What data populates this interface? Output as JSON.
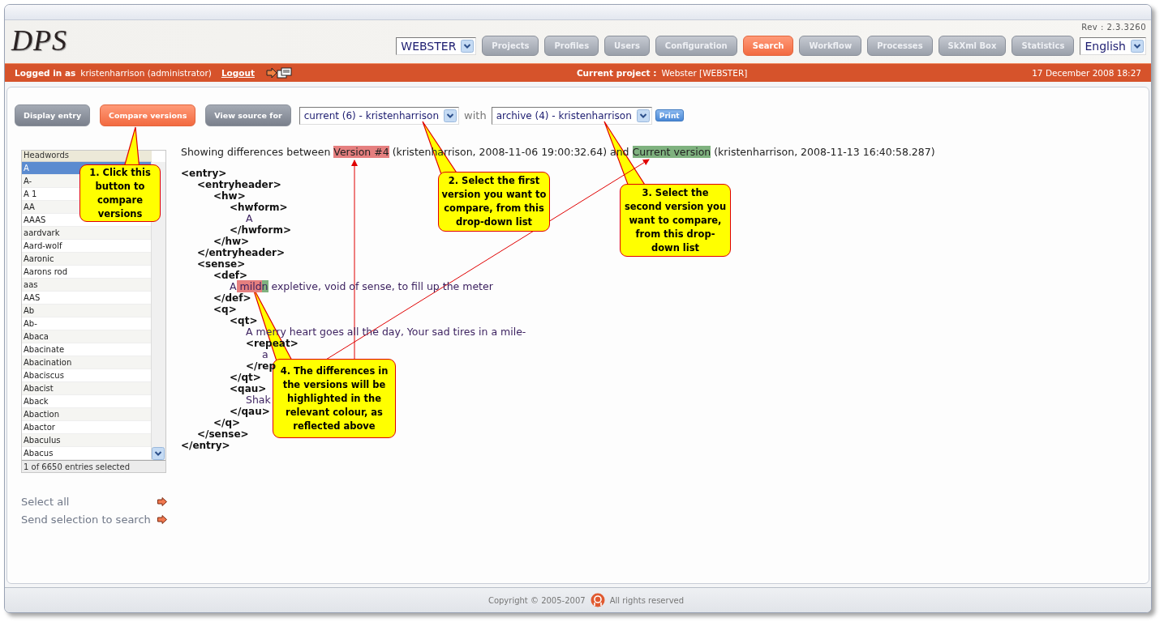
{
  "header": {
    "logo": "DPS",
    "revision": "Rev : 2.3.3260",
    "dictionary_select": "WEBSTER",
    "language_select": "English",
    "nav": [
      {
        "label": "Projects",
        "selected": false
      },
      {
        "label": "Profiles",
        "selected": false
      },
      {
        "label": "Users",
        "selected": false
      },
      {
        "label": "Configuration",
        "selected": false
      },
      {
        "label": "Search",
        "selected": true
      },
      {
        "label": "Workflow",
        "selected": false
      },
      {
        "label": "Processes",
        "selected": false
      },
      {
        "label": "SkXml Box",
        "selected": false
      },
      {
        "label": "Statistics",
        "selected": false
      }
    ]
  },
  "user_bar": {
    "logged_in_label": "Logged in as",
    "user": "kristenharrison (administrator)",
    "logout": "Logout",
    "current_project_label": "Current project :",
    "current_project": "Webster [WEBSTER]",
    "datetime": "17 December 2008 18:27"
  },
  "toolbar": {
    "modes": [
      {
        "label": "Display entry",
        "selected": false
      },
      {
        "label": "Compare versions",
        "selected": true
      },
      {
        "label": "View source for",
        "selected": false
      }
    ],
    "first_version": "current (6) - kristenharrison",
    "with_label": "with",
    "second_version": "archive (4) - kristenharrison",
    "print": "Print"
  },
  "headwords": {
    "heading": "Headwords",
    "status": "1 of 6650 entries selected",
    "items": [
      {
        "label": "A",
        "selected": true
      },
      {
        "label": "A-",
        "selected": false
      },
      {
        "label": "A 1",
        "selected": false
      },
      {
        "label": "AA",
        "selected": false
      },
      {
        "label": "AAAS",
        "selected": false
      },
      {
        "label": "aardvark",
        "selected": false
      },
      {
        "label": "Aard-wolf",
        "selected": false
      },
      {
        "label": "Aaronic",
        "selected": false
      },
      {
        "label": "Aarons rod",
        "selected": false
      },
      {
        "label": "aas",
        "selected": false
      },
      {
        "label": "AAS",
        "selected": false
      },
      {
        "label": "Ab",
        "selected": false
      },
      {
        "label": "Ab-",
        "selected": false
      },
      {
        "label": "Abaca",
        "selected": false
      },
      {
        "label": "Abacinate",
        "selected": false
      },
      {
        "label": "Abacination",
        "selected": false
      },
      {
        "label": "Abaciscus",
        "selected": false
      },
      {
        "label": "Abacist",
        "selected": false
      },
      {
        "label": "Aback",
        "selected": false
      },
      {
        "label": "Abaction",
        "selected": false
      },
      {
        "label": "Abactor",
        "selected": false
      },
      {
        "label": "Abaculus",
        "selected": false
      },
      {
        "label": "Abacus",
        "selected": false
      }
    ]
  },
  "actions": [
    "Select all",
    "Send selection to search"
  ],
  "diff": {
    "summary": [
      {
        "text": "Showing differences between ",
        "removed": false,
        "added": false
      },
      {
        "text": "Version #4",
        "removed": true,
        "added": false
      },
      {
        "text": " (kristenharrison, 2008-11-06 19:00:32.64) and ",
        "removed": false,
        "added": false
      },
      {
        "text": "Current version",
        "removed": false,
        "added": true
      },
      {
        "text": " (kristenharrison, 2008-11-13 16:40:58.287)",
        "removed": false,
        "added": false
      }
    ],
    "tree": {
      "kind": "element",
      "open": "<entry>",
      "close": "</entry>",
      "children": [
        {
          "kind": "element",
          "open": "<entryheader>",
          "close": "</entryheader>",
          "children": [
            {
              "kind": "element",
              "open": "<hw>",
              "close": "</hw>",
              "children": [
                {
                  "kind": "element",
                  "open": "<hwform>",
                  "close": "</hwform>",
                  "children": [
                    {
                      "kind": "text",
                      "segments": [
                        {
                          "text": "A",
                          "removed": false,
                          "added": false
                        }
                      ]
                    }
                  ]
                }
              ]
            }
          ]
        },
        {
          "kind": "element",
          "open": "<sense>",
          "close": "</sense>",
          "children": [
            {
              "kind": "element",
              "open": "<def>",
              "close": "</def>",
              "children": [
                {
                  "kind": "text",
                  "segments": [
                    {
                      "text": "A",
                      "removed": false,
                      "added": false
                    },
                    {
                      "text": " mild",
                      "removed": true,
                      "added": false
                    },
                    {
                      "text": "n",
                      "removed": false,
                      "added": true
                    },
                    {
                      "text": " expletive, void of sense, to fill up the meter",
                      "removed": false,
                      "added": false
                    }
                  ]
                }
              ]
            },
            {
              "kind": "element",
              "open": "<q>",
              "close": "</q>",
              "children": [
                {
                  "kind": "element",
                  "open": "<qt>",
                  "close": "</qt>",
                  "children": [
                    {
                      "kind": "text",
                      "segments": [
                        {
                          "text": "A merry heart goes all the day, Your sad tires in a mile-",
                          "removed": false,
                          "added": false
                        }
                      ]
                    },
                    {
                      "kind": "element",
                      "open": "<repeat>",
                      "close": "</rep",
                      "children": [
                        {
                          "kind": "text",
                          "segments": [
                            {
                              "text": "a",
                              "removed": false,
                              "added": false
                            }
                          ]
                        }
                      ]
                    }
                  ]
                },
                {
                  "kind": "element",
                  "open": "<qau>",
                  "close": "</qau>",
                  "children": [
                    {
                      "kind": "text",
                      "segments": [
                        {
                          "text": "Shak",
                          "removed": false,
                          "added": false
                        }
                      ]
                    }
                  ]
                }
              ]
            }
          ]
        }
      ]
    }
  },
  "callouts": [
    {
      "text": "1. Click this button to compare versions"
    },
    {
      "text": "2. Select the first version you want to compare, from this drop-down list"
    },
    {
      "text": "3. Select the second version you want to compare, from this drop-down list"
    },
    {
      "text": "4. The differences in the versions will be highlighted in the relevant colour, as reflected above"
    }
  ],
  "footer": {
    "copyright": "Copyright © 2005-2007",
    "rights": "All rights reserved"
  }
}
